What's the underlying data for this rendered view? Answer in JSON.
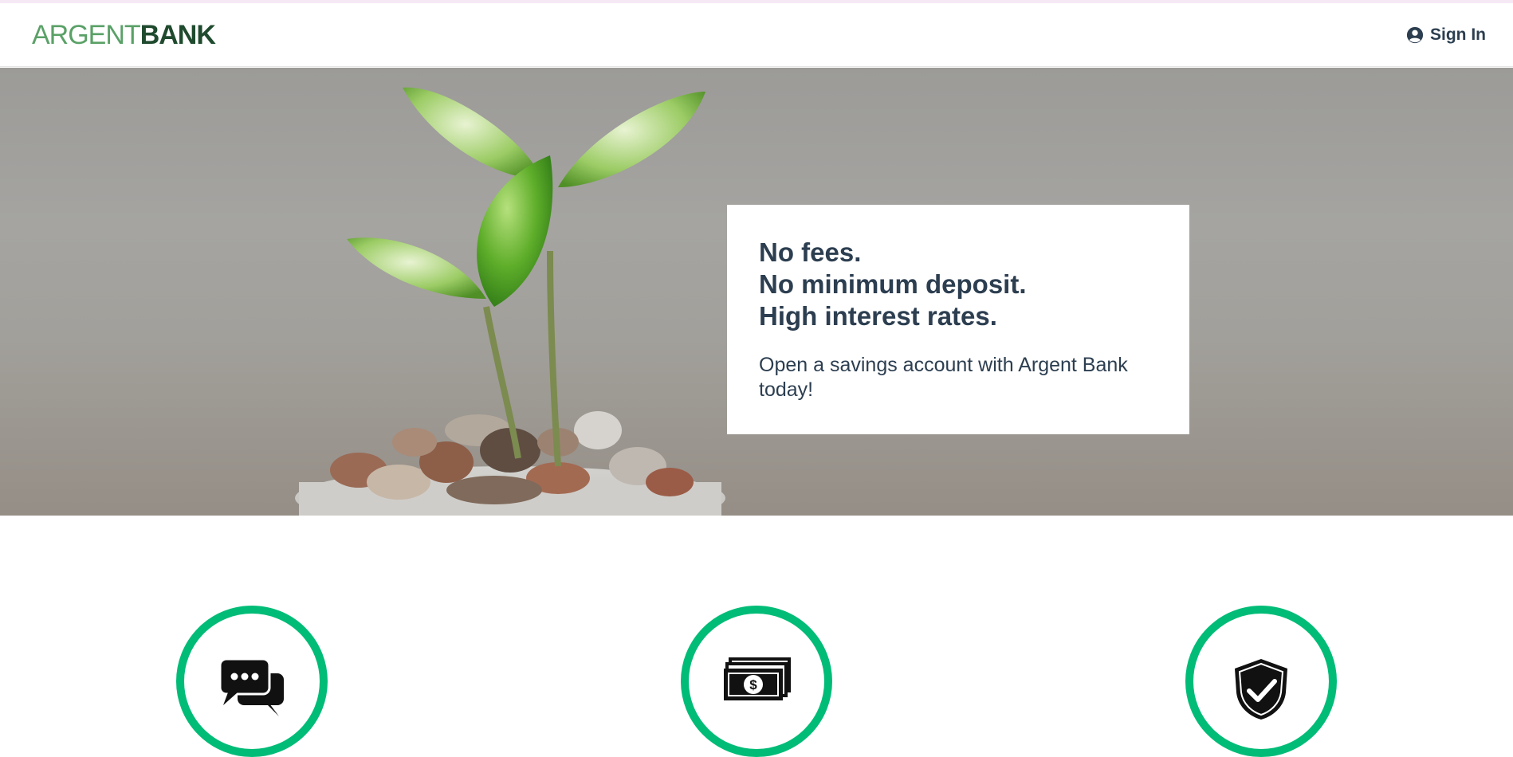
{
  "brand": {
    "name_part1": "ARGENT",
    "name_part2": "BANK",
    "primary_color": "#00bc77",
    "logo_light_color": "#5aa167",
    "logo_dark_color": "#1f4a2e"
  },
  "nav": {
    "signin_label": "Sign In",
    "signin_icon": "user-circle-icon"
  },
  "hero": {
    "image": "plant-in-coin-jar",
    "headline_lines": [
      "No fees.",
      "No minimum deposit.",
      "High interest rates."
    ],
    "subtitle": "Open a savings account with Argent Bank today!"
  },
  "features": [
    {
      "icon": "chat-icon"
    },
    {
      "icon": "money-icon"
    },
    {
      "icon": "security-shield-icon"
    }
  ]
}
